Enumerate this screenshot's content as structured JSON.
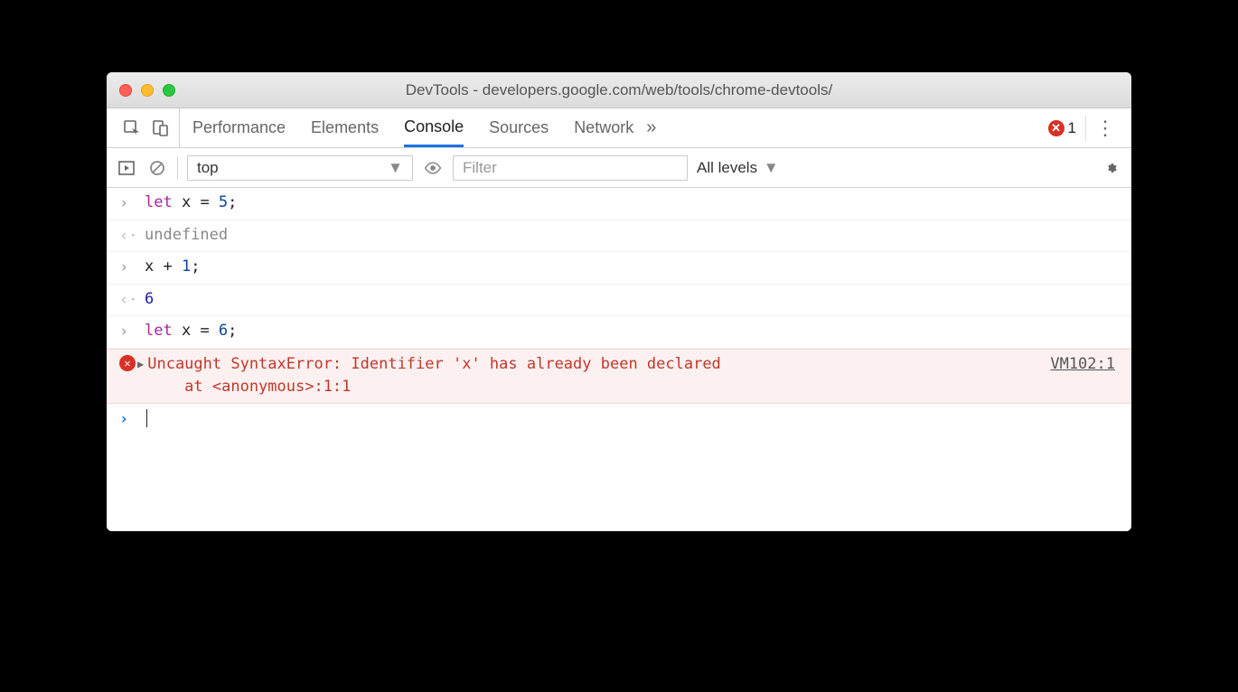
{
  "window": {
    "title": "DevTools - developers.google.com/web/tools/chrome-devtools/"
  },
  "tabs": {
    "items": [
      "Performance",
      "Elements",
      "Console",
      "Sources",
      "Network"
    ],
    "active_index": 2,
    "overflow_glyph": "»",
    "error_count": "1"
  },
  "filters": {
    "context": "top",
    "filter_placeholder": "Filter",
    "levels_label": "All levels"
  },
  "console": {
    "rows": [
      {
        "type": "input",
        "tokens": [
          [
            "kw",
            "let"
          ],
          [
            "plain",
            " x "
          ],
          [
            "plain",
            "= "
          ],
          [
            "num",
            "5"
          ],
          [
            "plain",
            ";"
          ]
        ]
      },
      {
        "type": "output",
        "tokens": [
          [
            "undef",
            "undefined"
          ]
        ]
      },
      {
        "type": "input",
        "tokens": [
          [
            "plain",
            "x "
          ],
          [
            "plain",
            "+ "
          ],
          [
            "num",
            "1"
          ],
          [
            "plain",
            ";"
          ]
        ]
      },
      {
        "type": "output",
        "tokens": [
          [
            "numres",
            "6"
          ]
        ]
      },
      {
        "type": "input",
        "tokens": [
          [
            "kw",
            "let"
          ],
          [
            "plain",
            " x "
          ],
          [
            "plain",
            "= "
          ],
          [
            "num",
            "6"
          ],
          [
            "plain",
            ";"
          ]
        ]
      }
    ],
    "error": {
      "message": "Uncaught SyntaxError: Identifier 'x' has already been declared\n    at <anonymous>:1:1",
      "source": "VM102:1"
    }
  }
}
